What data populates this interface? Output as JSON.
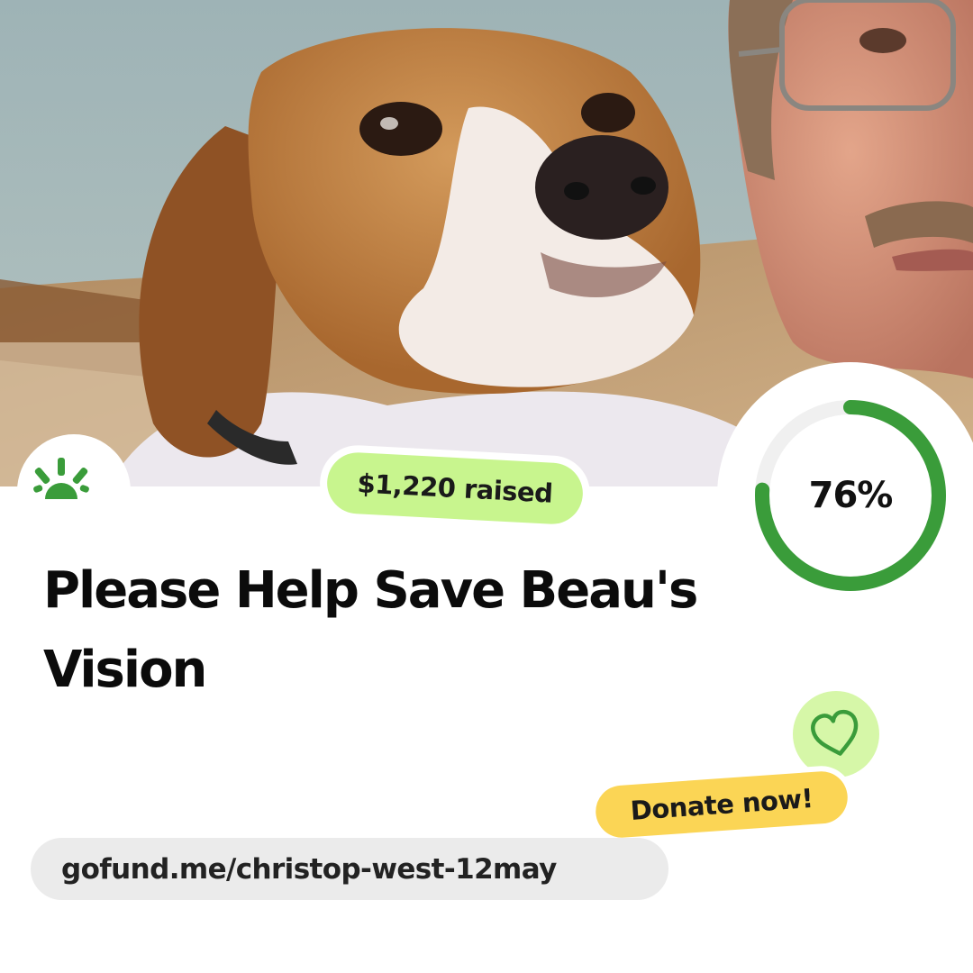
{
  "photo": {
    "alt": "Beagle dog resting next to a man wearing glasses"
  },
  "logo": {
    "icon": "gofundme-sun-icon",
    "color": "#3a9c3a"
  },
  "raised": {
    "label": "$1,220 raised",
    "color": "#c8f58e"
  },
  "progress": {
    "label": "76%",
    "value": 0.76,
    "color": "#3a9c3a",
    "track_color": "#f0f0f0"
  },
  "campaign": {
    "title": "Please Help Save Beau's Vision"
  },
  "donate": {
    "label": "Donate now!",
    "color": "#fbd555",
    "icon": "heart-icon",
    "icon_bg": "#d6f7a8"
  },
  "url": {
    "text": "gofund.me/christop-west-12may"
  }
}
